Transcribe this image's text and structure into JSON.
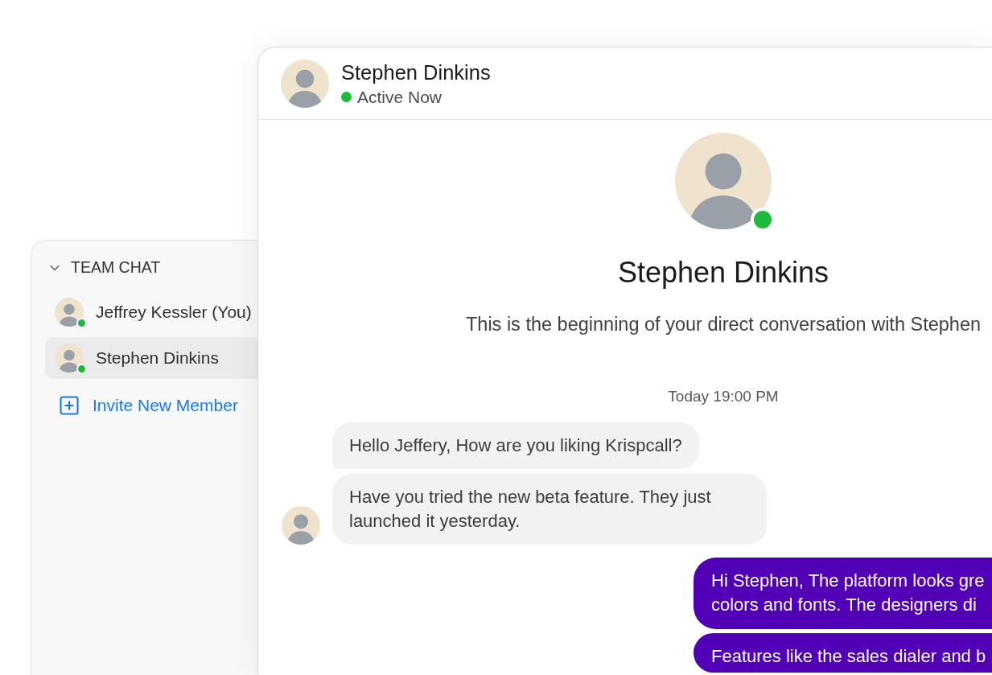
{
  "sidebar": {
    "section": {
      "title": "TEAM CHAT",
      "expanded": true
    },
    "members": [
      {
        "name": "Jeffrey Kessler (You)",
        "online": true,
        "selected": false
      },
      {
        "name": "Stephen Dinkins",
        "online": true,
        "selected": true
      }
    ],
    "invite": {
      "label": "Invite New Member"
    }
  },
  "chat_header": {
    "name": "Stephen Dinkins",
    "status": "Active Now",
    "online": true
  },
  "profile": {
    "name": "Stephen Dinkins",
    "online": true,
    "intro": "This is the beginning of your direct conversation with Stephen"
  },
  "timestamp": "Today 19:00 PM",
  "messages": [
    {
      "kind": "incoming",
      "lines": [
        "Hello Jeffery, How are you liking Krispcall?"
      ]
    },
    {
      "kind": "incoming",
      "lines": [
        "Have you tried the new beta feature. They just launched it yesterday."
      ]
    },
    {
      "kind": "outgoing",
      "lines": [
        "Hi Stephen, The platform looks gre",
        "colors and fonts. The designers di"
      ]
    },
    {
      "kind": "outgoing",
      "lines": [
        "Features like the sales dialer and b"
      ]
    }
  ]
}
